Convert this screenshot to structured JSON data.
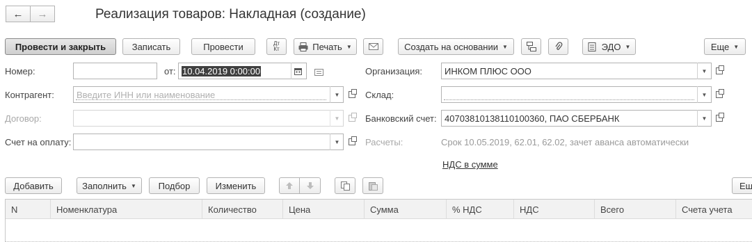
{
  "nav": {
    "back": "←",
    "forward": "→"
  },
  "title": "Реализация товаров: Накладная (создание)",
  "toolbar": {
    "post_close": "Провести и закрыть",
    "write": "Записать",
    "post": "Провести",
    "dt_kt_top": "Дт",
    "dt_kt_bottom": "Кт",
    "print": "Печать",
    "create_based": "Создать на основании",
    "edo": "ЭДО",
    "more": "Еще"
  },
  "form": {
    "number_label": "Номер:",
    "number_value": "",
    "from_label": "от:",
    "date_value": "10.04.2019  0:00:00",
    "counterparty_label": "Контрагент:",
    "counterparty_placeholder": "Введите ИНН или наименование",
    "contract_label": "Договор:",
    "invoice_label": "Счет на оплату:",
    "org_label": "Организация:",
    "org_value": "ИНКОМ ПЛЮС ООО",
    "warehouse_label": "Склад:",
    "warehouse_value": "",
    "bank_label": "Банковский счет:",
    "bank_value": "40703810138110100360, ПАО СБЕРБАНК",
    "settlements_label": "Расчеты:",
    "settlements_value": "Срок 10.05.2019, 62.01, 62.02, зачет аванса автоматически",
    "vat_link": "НДС в сумме"
  },
  "table_toolbar": {
    "add": "Добавить",
    "fill": "Заполнить",
    "selection": "Подбор",
    "change": "Изменить",
    "more": "Ещ"
  },
  "table": {
    "columns": [
      "N",
      "Номенклатура",
      "Количество",
      "Цена",
      "Сумма",
      "% НДС",
      "НДС",
      "Всего",
      "Счета учета"
    ]
  }
}
